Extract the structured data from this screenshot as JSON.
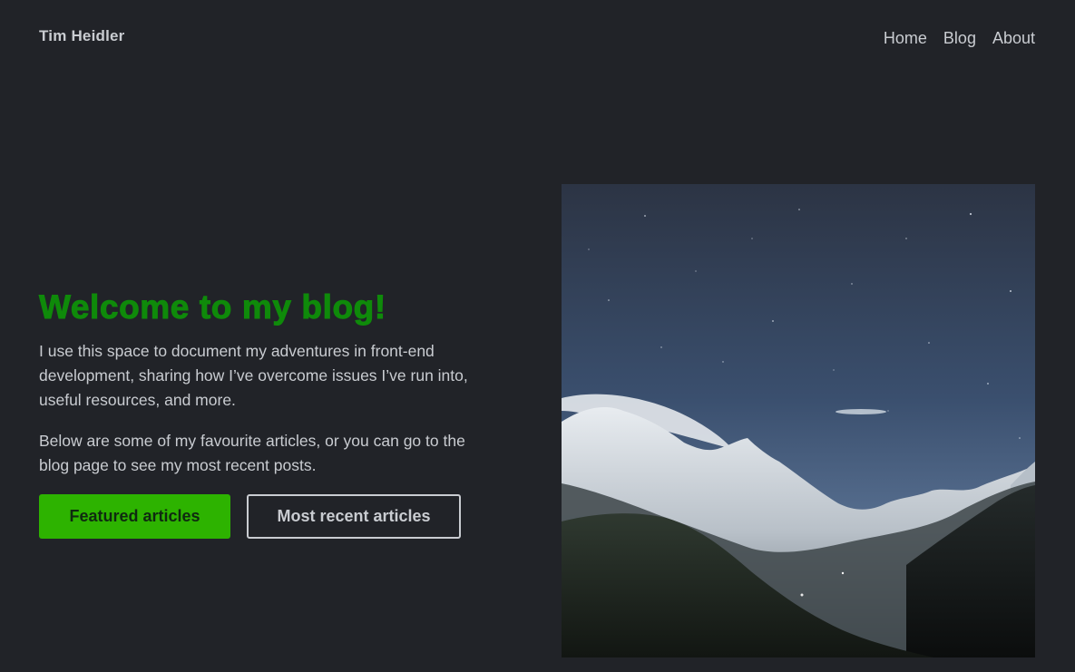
{
  "header": {
    "brand": "Tim Heidler",
    "nav": [
      "Home",
      "Blog",
      "About"
    ]
  },
  "hero": {
    "title": "Welcome to my blog!",
    "paragraphs": [
      "I use this space to document my adventures in front-end development, sharing how I’ve overcome issues I’ve run into, useful resources, and more.",
      "Below are some of my favourite articles, or you can go to the blog page to see my most recent posts."
    ],
    "buttons": {
      "primary": "Featured articles",
      "secondary": "Most recent articles"
    }
  },
  "image": {
    "subject": "snow-capped mountains under a night sky"
  },
  "colors": {
    "background": "#212328",
    "accent_green": "#0f8a0a",
    "button_green": "#2db300",
    "text": "#c9ccd1"
  }
}
